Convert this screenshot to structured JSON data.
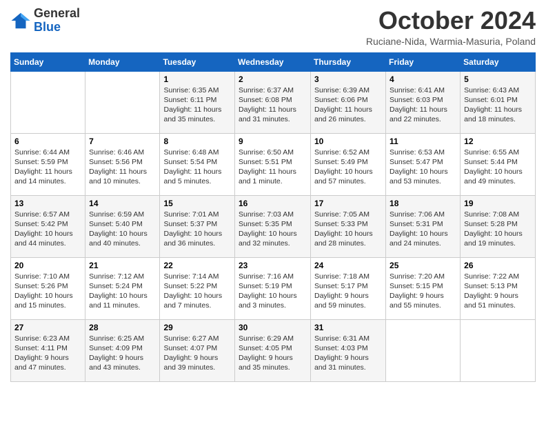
{
  "header": {
    "logo_line1": "General",
    "logo_line2": "Blue",
    "month_title": "October 2024",
    "location": "Ruciane-Nida, Warmia-Masuria, Poland"
  },
  "days_of_week": [
    "Sunday",
    "Monday",
    "Tuesday",
    "Wednesday",
    "Thursday",
    "Friday",
    "Saturday"
  ],
  "weeks": [
    [
      {
        "day": "",
        "sunrise": "",
        "sunset": "",
        "daylight": ""
      },
      {
        "day": "",
        "sunrise": "",
        "sunset": "",
        "daylight": ""
      },
      {
        "day": "1",
        "sunrise": "Sunrise: 6:35 AM",
        "sunset": "Sunset: 6:11 PM",
        "daylight": "Daylight: 11 hours and 35 minutes."
      },
      {
        "day": "2",
        "sunrise": "Sunrise: 6:37 AM",
        "sunset": "Sunset: 6:08 PM",
        "daylight": "Daylight: 11 hours and 31 minutes."
      },
      {
        "day": "3",
        "sunrise": "Sunrise: 6:39 AM",
        "sunset": "Sunset: 6:06 PM",
        "daylight": "Daylight: 11 hours and 26 minutes."
      },
      {
        "day": "4",
        "sunrise": "Sunrise: 6:41 AM",
        "sunset": "Sunset: 6:03 PM",
        "daylight": "Daylight: 11 hours and 22 minutes."
      },
      {
        "day": "5",
        "sunrise": "Sunrise: 6:43 AM",
        "sunset": "Sunset: 6:01 PM",
        "daylight": "Daylight: 11 hours and 18 minutes."
      }
    ],
    [
      {
        "day": "6",
        "sunrise": "Sunrise: 6:44 AM",
        "sunset": "Sunset: 5:59 PM",
        "daylight": "Daylight: 11 hours and 14 minutes."
      },
      {
        "day": "7",
        "sunrise": "Sunrise: 6:46 AM",
        "sunset": "Sunset: 5:56 PM",
        "daylight": "Daylight: 11 hours and 10 minutes."
      },
      {
        "day": "8",
        "sunrise": "Sunrise: 6:48 AM",
        "sunset": "Sunset: 5:54 PM",
        "daylight": "Daylight: 11 hours and 5 minutes."
      },
      {
        "day": "9",
        "sunrise": "Sunrise: 6:50 AM",
        "sunset": "Sunset: 5:51 PM",
        "daylight": "Daylight: 11 hours and 1 minute."
      },
      {
        "day": "10",
        "sunrise": "Sunrise: 6:52 AM",
        "sunset": "Sunset: 5:49 PM",
        "daylight": "Daylight: 10 hours and 57 minutes."
      },
      {
        "day": "11",
        "sunrise": "Sunrise: 6:53 AM",
        "sunset": "Sunset: 5:47 PM",
        "daylight": "Daylight: 10 hours and 53 minutes."
      },
      {
        "day": "12",
        "sunrise": "Sunrise: 6:55 AM",
        "sunset": "Sunset: 5:44 PM",
        "daylight": "Daylight: 10 hours and 49 minutes."
      }
    ],
    [
      {
        "day": "13",
        "sunrise": "Sunrise: 6:57 AM",
        "sunset": "Sunset: 5:42 PM",
        "daylight": "Daylight: 10 hours and 44 minutes."
      },
      {
        "day": "14",
        "sunrise": "Sunrise: 6:59 AM",
        "sunset": "Sunset: 5:40 PM",
        "daylight": "Daylight: 10 hours and 40 minutes."
      },
      {
        "day": "15",
        "sunrise": "Sunrise: 7:01 AM",
        "sunset": "Sunset: 5:37 PM",
        "daylight": "Daylight: 10 hours and 36 minutes."
      },
      {
        "day": "16",
        "sunrise": "Sunrise: 7:03 AM",
        "sunset": "Sunset: 5:35 PM",
        "daylight": "Daylight: 10 hours and 32 minutes."
      },
      {
        "day": "17",
        "sunrise": "Sunrise: 7:05 AM",
        "sunset": "Sunset: 5:33 PM",
        "daylight": "Daylight: 10 hours and 28 minutes."
      },
      {
        "day": "18",
        "sunrise": "Sunrise: 7:06 AM",
        "sunset": "Sunset: 5:31 PM",
        "daylight": "Daylight: 10 hours and 24 minutes."
      },
      {
        "day": "19",
        "sunrise": "Sunrise: 7:08 AM",
        "sunset": "Sunset: 5:28 PM",
        "daylight": "Daylight: 10 hours and 19 minutes."
      }
    ],
    [
      {
        "day": "20",
        "sunrise": "Sunrise: 7:10 AM",
        "sunset": "Sunset: 5:26 PM",
        "daylight": "Daylight: 10 hours and 15 minutes."
      },
      {
        "day": "21",
        "sunrise": "Sunrise: 7:12 AM",
        "sunset": "Sunset: 5:24 PM",
        "daylight": "Daylight: 10 hours and 11 minutes."
      },
      {
        "day": "22",
        "sunrise": "Sunrise: 7:14 AM",
        "sunset": "Sunset: 5:22 PM",
        "daylight": "Daylight: 10 hours and 7 minutes."
      },
      {
        "day": "23",
        "sunrise": "Sunrise: 7:16 AM",
        "sunset": "Sunset: 5:19 PM",
        "daylight": "Daylight: 10 hours and 3 minutes."
      },
      {
        "day": "24",
        "sunrise": "Sunrise: 7:18 AM",
        "sunset": "Sunset: 5:17 PM",
        "daylight": "Daylight: 9 hours and 59 minutes."
      },
      {
        "day": "25",
        "sunrise": "Sunrise: 7:20 AM",
        "sunset": "Sunset: 5:15 PM",
        "daylight": "Daylight: 9 hours and 55 minutes."
      },
      {
        "day": "26",
        "sunrise": "Sunrise: 7:22 AM",
        "sunset": "Sunset: 5:13 PM",
        "daylight": "Daylight: 9 hours and 51 minutes."
      }
    ],
    [
      {
        "day": "27",
        "sunrise": "Sunrise: 6:23 AM",
        "sunset": "Sunset: 4:11 PM",
        "daylight": "Daylight: 9 hours and 47 minutes."
      },
      {
        "day": "28",
        "sunrise": "Sunrise: 6:25 AM",
        "sunset": "Sunset: 4:09 PM",
        "daylight": "Daylight: 9 hours and 43 minutes."
      },
      {
        "day": "29",
        "sunrise": "Sunrise: 6:27 AM",
        "sunset": "Sunset: 4:07 PM",
        "daylight": "Daylight: 9 hours and 39 minutes."
      },
      {
        "day": "30",
        "sunrise": "Sunrise: 6:29 AM",
        "sunset": "Sunset: 4:05 PM",
        "daylight": "Daylight: 9 hours and 35 minutes."
      },
      {
        "day": "31",
        "sunrise": "Sunrise: 6:31 AM",
        "sunset": "Sunset: 4:03 PM",
        "daylight": "Daylight: 9 hours and 31 minutes."
      },
      {
        "day": "",
        "sunrise": "",
        "sunset": "",
        "daylight": ""
      },
      {
        "day": "",
        "sunrise": "",
        "sunset": "",
        "daylight": ""
      }
    ]
  ]
}
